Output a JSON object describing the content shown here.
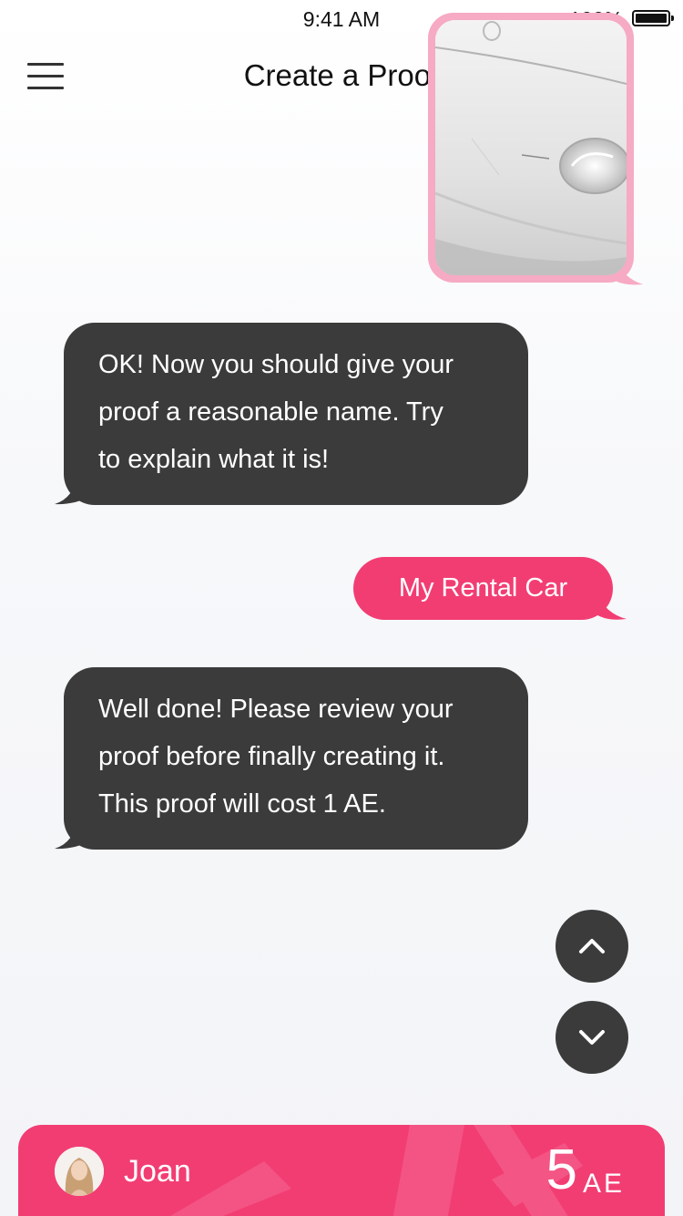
{
  "status_bar": {
    "time": "9:41 AM",
    "battery": "100%"
  },
  "header": {
    "title": "Create a Proof",
    "menu_icon": "hamburger-menu-icon"
  },
  "chat": {
    "photo": {
      "description_icon": "car-photo"
    },
    "messages": [
      {
        "from": "bot",
        "text_lines": [
          "OK! Now you should give your",
          "proof a reasonable name. Try",
          "to explain what it is!"
        ]
      },
      {
        "from": "user",
        "text": "My Rental Car"
      },
      {
        "from": "bot",
        "text_lines": [
          "Well done! Please review your",
          "proof before finally creating it.",
          "This proof will cost 1 AE."
        ]
      }
    ]
  },
  "scroll_controls": {
    "up_icon": "chevron-up-icon",
    "down_icon": "chevron-down-icon"
  },
  "account": {
    "name": "Joan",
    "balance": "5",
    "unit": "AE"
  },
  "colors": {
    "accent": "#f23d73",
    "bubble_dark": "#3b3b3b",
    "photo_frame": "#f6aac3"
  }
}
